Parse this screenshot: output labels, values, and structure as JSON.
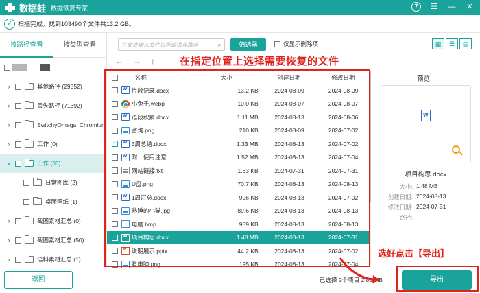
{
  "app": {
    "name": "数据蛙",
    "subtitle": "数据恢复专家",
    "accent_color": "#1aa39a",
    "annotation_color": "#e0241c"
  },
  "status": {
    "text": "扫描完成。找到103490个文件共13.2 GB。"
  },
  "left_tabs": {
    "by_path": "按路径查看",
    "by_type": "按类型查看"
  },
  "tree": [
    {
      "label": "其他路径 (29352)",
      "expanded": false
    },
    {
      "label": "丢失路径 (71392)",
      "expanded": false
    },
    {
      "label": "SwitchyOmega_Chromium",
      "expanded": false
    },
    {
      "label": "工作 (0)",
      "expanded": false
    },
    {
      "label": "工作 (33)",
      "expanded": true,
      "selected": true
    },
    {
      "label": "日常图库 (2)",
      "child": true
    },
    {
      "label": "桌面壁纸 (1)",
      "child": true
    },
    {
      "label": "截图素材汇总 (0)",
      "expanded": false
    },
    {
      "label": "截图素材汇总 (50)",
      "expanded": false
    },
    {
      "label": "语料素材汇总 (1)",
      "expanded": false
    }
  ],
  "toolbar": {
    "search_placeholder": "在此处输入文件名称或保存路径",
    "filter_label": "筛选器",
    "deleted_only_label": "仅显示删除项"
  },
  "annotations": {
    "select_hint": "在指定位置上选择需要恢复的文件",
    "export_hint": "选好点击【导出】"
  },
  "table": {
    "headers": {
      "name": "名称",
      "size": "大小",
      "created": "创建日期",
      "modified": "修改日期"
    },
    "rows": [
      {
        "name": "片段记录.docx",
        "icon": "word-icon",
        "size": "13.2 KB",
        "created": "2024-08-09",
        "modified": "2024-08-09",
        "checked": false
      },
      {
        "name": "小兔子.webp",
        "icon": "chrome-icon",
        "size": "10.0 KB",
        "created": "2024-08-07",
        "modified": "2024-08-07",
        "checked": false
      },
      {
        "name": "语段积累.docx",
        "icon": "word-icon",
        "size": "1.11 MB",
        "created": "2024-08-13",
        "modified": "2024-08-06",
        "checked": false
      },
      {
        "name": "咨询.png",
        "icon": "image-icon",
        "size": "210 KB",
        "created": "2024-08-09",
        "modified": "2024-07-02",
        "checked": false
      },
      {
        "name": "3周总结.docx",
        "icon": "word-icon",
        "size": "1.33 MB",
        "created": "2024-08-13",
        "modified": "2024-07-02",
        "checked": true
      },
      {
        "name": "附：使用注意...",
        "icon": "word-icon",
        "size": "1.52 MB",
        "created": "2024-08-13",
        "modified": "2024-07-04",
        "checked": false
      },
      {
        "name": "网站链接.txt",
        "icon": "text-icon",
        "size": "1.63 KB",
        "created": "2024-07-31",
        "modified": "2024-07-31",
        "checked": false
      },
      {
        "name": "U盘.png",
        "icon": "image-icon",
        "size": "70.7 KB",
        "created": "2024-08-13",
        "modified": "2024-08-13",
        "checked": false
      },
      {
        "name": "1周汇总.docx",
        "icon": "word-icon",
        "size": "996 KB",
        "created": "2024-08-13",
        "modified": "2024-07-02",
        "checked": false
      },
      {
        "name": "熟睡的小猫.jpg",
        "icon": "image-icon",
        "size": "89.6 KB",
        "created": "2024-08-13",
        "modified": "2024-08-13",
        "checked": false
      },
      {
        "name": "电脑.bmp",
        "icon": "bmp-icon",
        "size": "959 KB",
        "created": "2024-08-13",
        "modified": "2024-08-13",
        "checked": false
      },
      {
        "name": "项目构思.docx",
        "icon": "word-icon",
        "size": "1.48 MB",
        "created": "2024-08-13",
        "modified": "2024-07-31",
        "checked": true,
        "selected": true
      },
      {
        "name": "说明展示.pptx",
        "icon": "ppt-icon",
        "size": "44.2 KB",
        "created": "2024-08-13",
        "modified": "2024-07-02",
        "checked": false
      },
      {
        "name": "看电脑.png",
        "icon": "image-icon",
        "size": "195 KB",
        "created": "2024-08-13",
        "modified": "2024-07-04",
        "checked": false
      }
    ]
  },
  "preview": {
    "title": "预览",
    "file_name": "项目构思.docx",
    "meta": [
      {
        "key": "大小:",
        "value": "1.48 MB"
      },
      {
        "key": "创建日期:",
        "value": "2024-08-13"
      },
      {
        "key": "修改日期:",
        "value": "2024-07-31"
      },
      {
        "key": "路径:",
        "value": ""
      }
    ]
  },
  "bottom": {
    "back_label": "返回",
    "selection_info": "已选择 2个项目 2.85 MB",
    "export_label": "导出"
  }
}
